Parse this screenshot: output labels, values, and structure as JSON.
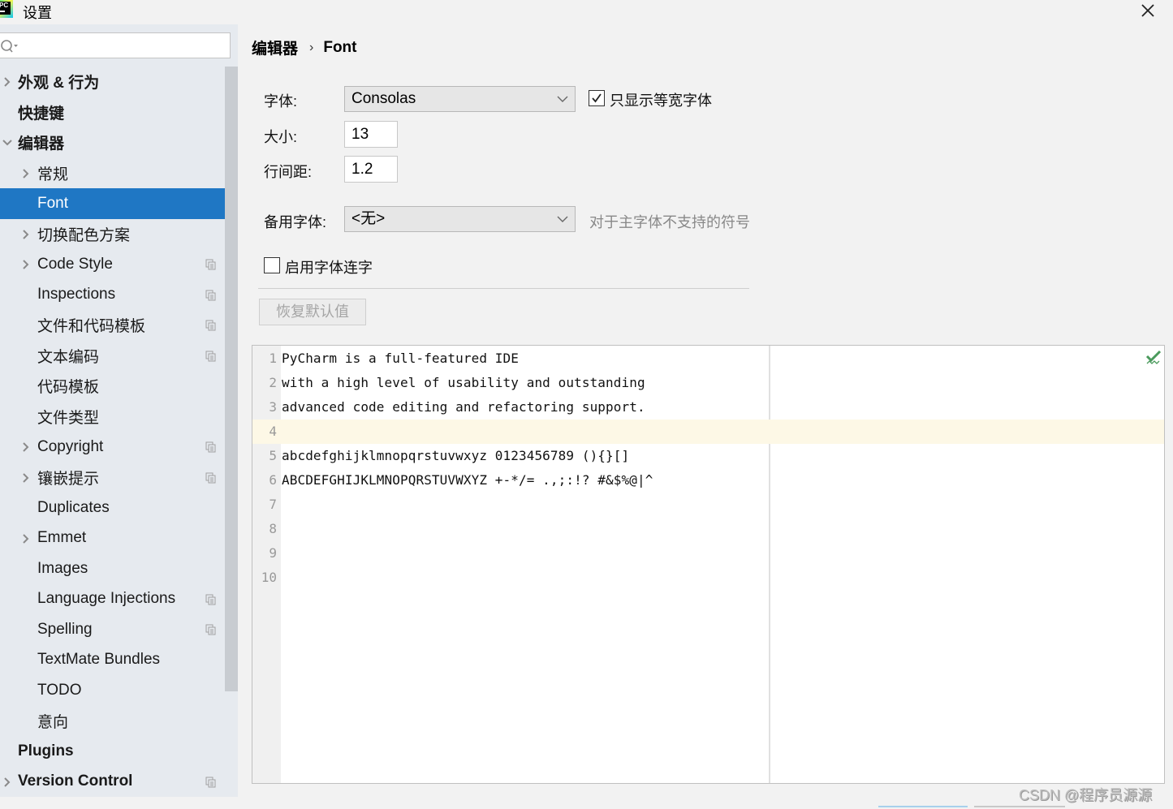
{
  "window": {
    "title": "设置",
    "close_icon": "close-icon"
  },
  "sidebar": {
    "search": {
      "value": "",
      "placeholder": ""
    },
    "items": [
      {
        "label": "外观 & 行为",
        "level": 0,
        "bold": true,
        "expandable": true,
        "expanded": false,
        "copy_icon": false
      },
      {
        "label": "快捷键",
        "level": 0,
        "bold": true,
        "expandable": false,
        "copy_icon": false
      },
      {
        "label": "编辑器",
        "level": 0,
        "bold": true,
        "expandable": true,
        "expanded": true,
        "copy_icon": false
      },
      {
        "label": "常规",
        "level": 1,
        "expandable": true,
        "expanded": false,
        "copy_icon": false
      },
      {
        "label": "Font",
        "level": 1,
        "expandable": false,
        "selected": true,
        "copy_icon": false
      },
      {
        "label": "切换配色方案",
        "level": 1,
        "expandable": true,
        "expanded": false,
        "copy_icon": false
      },
      {
        "label": "Code Style",
        "level": 1,
        "expandable": true,
        "expanded": false,
        "copy_icon": true
      },
      {
        "label": "Inspections",
        "level": 1,
        "expandable": false,
        "copy_icon": true
      },
      {
        "label": "文件和代码模板",
        "level": 1,
        "expandable": false,
        "copy_icon": true
      },
      {
        "label": "文本编码",
        "level": 1,
        "expandable": false,
        "copy_icon": true
      },
      {
        "label": "代码模板",
        "level": 1,
        "expandable": false,
        "copy_icon": false
      },
      {
        "label": "文件类型",
        "level": 1,
        "expandable": false,
        "copy_icon": false
      },
      {
        "label": "Copyright",
        "level": 1,
        "expandable": true,
        "expanded": false,
        "copy_icon": true
      },
      {
        "label": "镶嵌提示",
        "level": 1,
        "expandable": true,
        "expanded": false,
        "copy_icon": true
      },
      {
        "label": "Duplicates",
        "level": 1,
        "expandable": false,
        "copy_icon": false
      },
      {
        "label": "Emmet",
        "level": 1,
        "expandable": true,
        "expanded": false,
        "copy_icon": false
      },
      {
        "label": "Images",
        "level": 1,
        "expandable": false,
        "copy_icon": false
      },
      {
        "label": "Language Injections",
        "level": 1,
        "expandable": false,
        "copy_icon": true
      },
      {
        "label": "Spelling",
        "level": 1,
        "expandable": false,
        "copy_icon": true
      },
      {
        "label": "TextMate Bundles",
        "level": 1,
        "expandable": false,
        "copy_icon": false
      },
      {
        "label": "TODO",
        "level": 1,
        "expandable": false,
        "copy_icon": false
      },
      {
        "label": "意向",
        "level": 1,
        "expandable": false,
        "copy_icon": false
      },
      {
        "label": "Plugins",
        "level": 0,
        "bold": true,
        "expandable": false,
        "copy_icon": false
      },
      {
        "label": "Version Control",
        "level": 0,
        "bold": true,
        "expandable": true,
        "expanded": false,
        "copy_icon": true
      }
    ]
  },
  "breadcrumb": {
    "parent": "编辑器",
    "separator": "›",
    "current": "Font"
  },
  "form": {
    "font_label": "字体:",
    "font_value": "Consolas",
    "monospace_only_label": "只显示等宽字体",
    "monospace_only_checked": true,
    "size_label": "大小:",
    "size_value": "13",
    "line_spacing_label": "行间距:",
    "line_spacing_value": "1.2",
    "fallback_label": "备用字体:",
    "fallback_value": "<无>",
    "fallback_hint": "对于主字体不支持的符号",
    "ligatures_label": "启用字体连字",
    "ligatures_checked": false,
    "restore_defaults_label": "恢复默认值",
    "restore_defaults_enabled": false
  },
  "preview": {
    "lines": [
      {
        "n": "1",
        "text": "PyCharm is a full-featured IDE"
      },
      {
        "n": "2",
        "text": "with a high level of usability and outstanding"
      },
      {
        "n": "3",
        "text": "advanced code editing and refactoring support."
      },
      {
        "n": "4",
        "text": "",
        "current": true
      },
      {
        "n": "5",
        "text": "abcdefghijklmnopqrstuvwxyz 0123456789 (){}[]"
      },
      {
        "n": "6",
        "text": "ABCDEFGHIJKLMNOPQRSTUVWXYZ +-*/= .,;:!? #&$%@|^"
      },
      {
        "n": "7",
        "text": ""
      },
      {
        "n": "8",
        "text": ""
      },
      {
        "n": "9",
        "text": ""
      },
      {
        "n": "10",
        "text": ""
      }
    ],
    "status_icon": "inspection-ok-icon"
  },
  "watermark": "CSDN @程序员源源",
  "colors": {
    "selection": "#1f77c4",
    "sidebar_bg": "#e6eaef",
    "current_line": "#fdf8e6",
    "ok_green": "#4a9a5c"
  }
}
